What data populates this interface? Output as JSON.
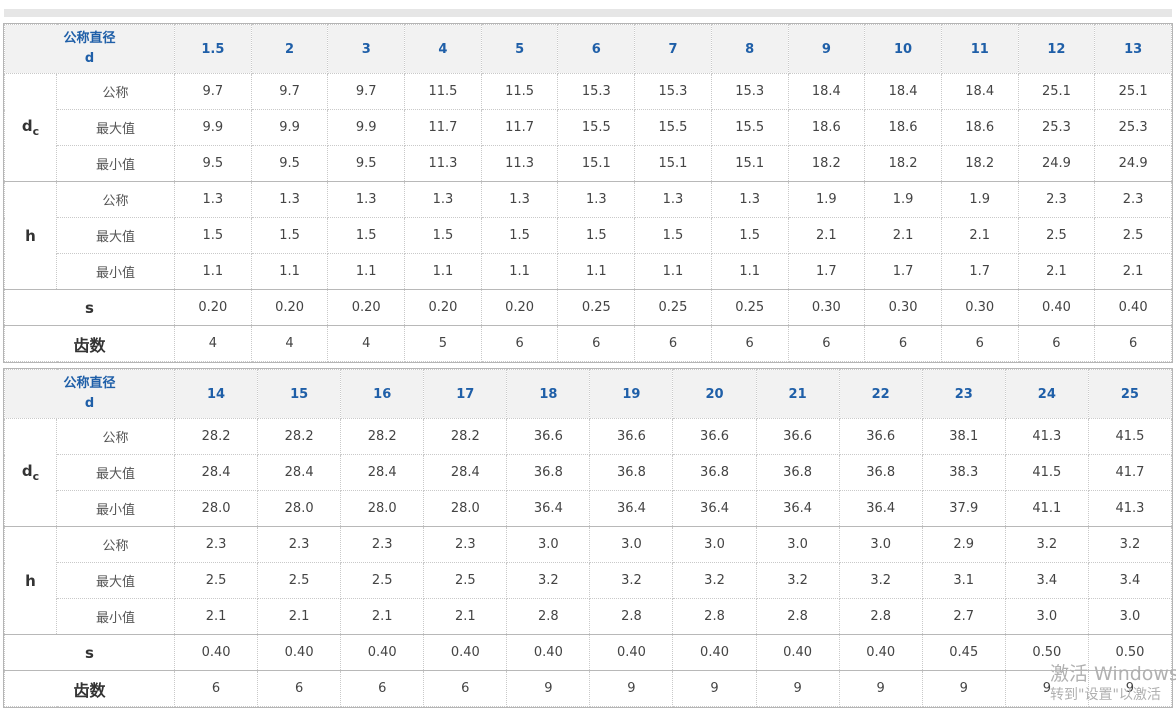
{
  "header": {
    "corner_line1": "公称直径",
    "corner_line2": "d"
  },
  "row_labels": {
    "dc_main": "d",
    "dc_sub": "c",
    "h": "h",
    "nominal": "公称",
    "max": "最大值",
    "min": "最小值",
    "s": "s",
    "teeth": "齿数"
  },
  "tables": [
    {
      "d": [
        "1.5",
        "2",
        "3",
        "4",
        "5",
        "6",
        "7",
        "8",
        "9",
        "10",
        "11",
        "12",
        "13"
      ],
      "dc_nominal": [
        "9.7",
        "9.7",
        "9.7",
        "11.5",
        "11.5",
        "15.3",
        "15.3",
        "15.3",
        "18.4",
        "18.4",
        "18.4",
        "25.1",
        "25.1"
      ],
      "dc_max": [
        "9.9",
        "9.9",
        "9.9",
        "11.7",
        "11.7",
        "15.5",
        "15.5",
        "15.5",
        "18.6",
        "18.6",
        "18.6",
        "25.3",
        "25.3"
      ],
      "dc_min": [
        "9.5",
        "9.5",
        "9.5",
        "11.3",
        "11.3",
        "15.1",
        "15.1",
        "15.1",
        "18.2",
        "18.2",
        "18.2",
        "24.9",
        "24.9"
      ],
      "h_nominal": [
        "1.3",
        "1.3",
        "1.3",
        "1.3",
        "1.3",
        "1.3",
        "1.3",
        "1.3",
        "1.9",
        "1.9",
        "1.9",
        "2.3",
        "2.3"
      ],
      "h_max": [
        "1.5",
        "1.5",
        "1.5",
        "1.5",
        "1.5",
        "1.5",
        "1.5",
        "1.5",
        "2.1",
        "2.1",
        "2.1",
        "2.5",
        "2.5"
      ],
      "h_min": [
        "1.1",
        "1.1",
        "1.1",
        "1.1",
        "1.1",
        "1.1",
        "1.1",
        "1.1",
        "1.7",
        "1.7",
        "1.7",
        "2.1",
        "2.1"
      ],
      "s": [
        "0.20",
        "0.20",
        "0.20",
        "0.20",
        "0.20",
        "0.25",
        "0.25",
        "0.25",
        "0.30",
        "0.30",
        "0.30",
        "0.40",
        "0.40"
      ],
      "teeth": [
        "4",
        "4",
        "4",
        "5",
        "6",
        "6",
        "6",
        "6",
        "6",
        "6",
        "6",
        "6",
        "6"
      ]
    },
    {
      "d": [
        "14",
        "15",
        "16",
        "17",
        "18",
        "19",
        "20",
        "21",
        "22",
        "23",
        "24",
        "25"
      ],
      "dc_nominal": [
        "28.2",
        "28.2",
        "28.2",
        "28.2",
        "36.6",
        "36.6",
        "36.6",
        "36.6",
        "36.6",
        "38.1",
        "41.3",
        "41.5"
      ],
      "dc_max": [
        "28.4",
        "28.4",
        "28.4",
        "28.4",
        "36.8",
        "36.8",
        "36.8",
        "36.8",
        "36.8",
        "38.3",
        "41.5",
        "41.7"
      ],
      "dc_min": [
        "28.0",
        "28.0",
        "28.0",
        "28.0",
        "36.4",
        "36.4",
        "36.4",
        "36.4",
        "36.4",
        "37.9",
        "41.1",
        "41.3"
      ],
      "h_nominal": [
        "2.3",
        "2.3",
        "2.3",
        "2.3",
        "3.0",
        "3.0",
        "3.0",
        "3.0",
        "3.0",
        "2.9",
        "3.2",
        "3.2"
      ],
      "h_max": [
        "2.5",
        "2.5",
        "2.5",
        "2.5",
        "3.2",
        "3.2",
        "3.2",
        "3.2",
        "3.2",
        "3.1",
        "3.4",
        "3.4"
      ],
      "h_min": [
        "2.1",
        "2.1",
        "2.1",
        "2.1",
        "2.8",
        "2.8",
        "2.8",
        "2.8",
        "2.8",
        "2.7",
        "3.0",
        "3.0"
      ],
      "s": [
        "0.40",
        "0.40",
        "0.40",
        "0.40",
        "0.40",
        "0.40",
        "0.40",
        "0.40",
        "0.40",
        "0.45",
        "0.50",
        "0.50"
      ],
      "teeth": [
        "6",
        "6",
        "6",
        "6",
        "9",
        "9",
        "9",
        "9",
        "9",
        "9",
        "9",
        "9"
      ]
    }
  ],
  "watermark": {
    "line1": "激活 Windows",
    "line2": "转到\"设置\"以激活"
  },
  "colors": {
    "header_bg": "#f2f2f2",
    "corner_bg": "#e8e8e8",
    "header_text": "#1f5fa8"
  }
}
